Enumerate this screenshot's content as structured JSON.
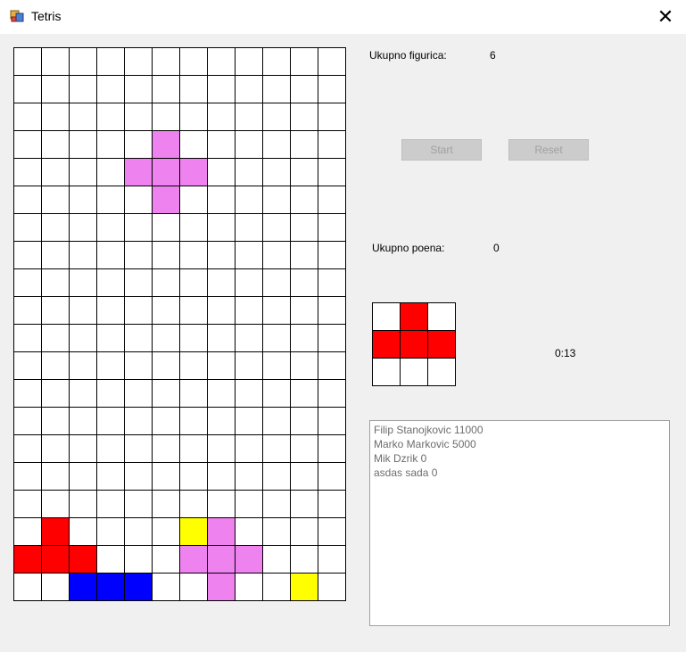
{
  "window": {
    "title": "Tetris",
    "close_symbol": "✕"
  },
  "colors": {
    "red": "#ff0000",
    "blue": "#0000ff",
    "yellow": "#ffff00",
    "pink": "#ee82ee",
    "empty": "#ffffff"
  },
  "board": {
    "columns": 12,
    "rows": [
      "............",
      "............",
      "............",
      ".....P......",
      "....PPP.....",
      ".....P......",
      "............",
      "............",
      "............",
      "............",
      "............",
      "............",
      "............",
      "............",
      "............",
      "............",
      "............",
      ".R....YP....",
      "RRR...PPP...",
      "..BBB..P..Y."
    ]
  },
  "stats": {
    "total_pieces_label": "Ukupno figurica:",
    "total_pieces_value": "6",
    "total_points_label": "Ukupno poena:",
    "total_points_value": "0",
    "timer": "0:13"
  },
  "buttons": {
    "start": "Start",
    "reset": "Reset"
  },
  "next_piece": {
    "rows": [
      ".R.",
      "RRR",
      "..."
    ]
  },
  "highscores": [
    "Filip Stanojkovic 11000",
    "Marko Markovic 5000",
    "Mik Dzrik 0",
    "asdas sada 0"
  ]
}
